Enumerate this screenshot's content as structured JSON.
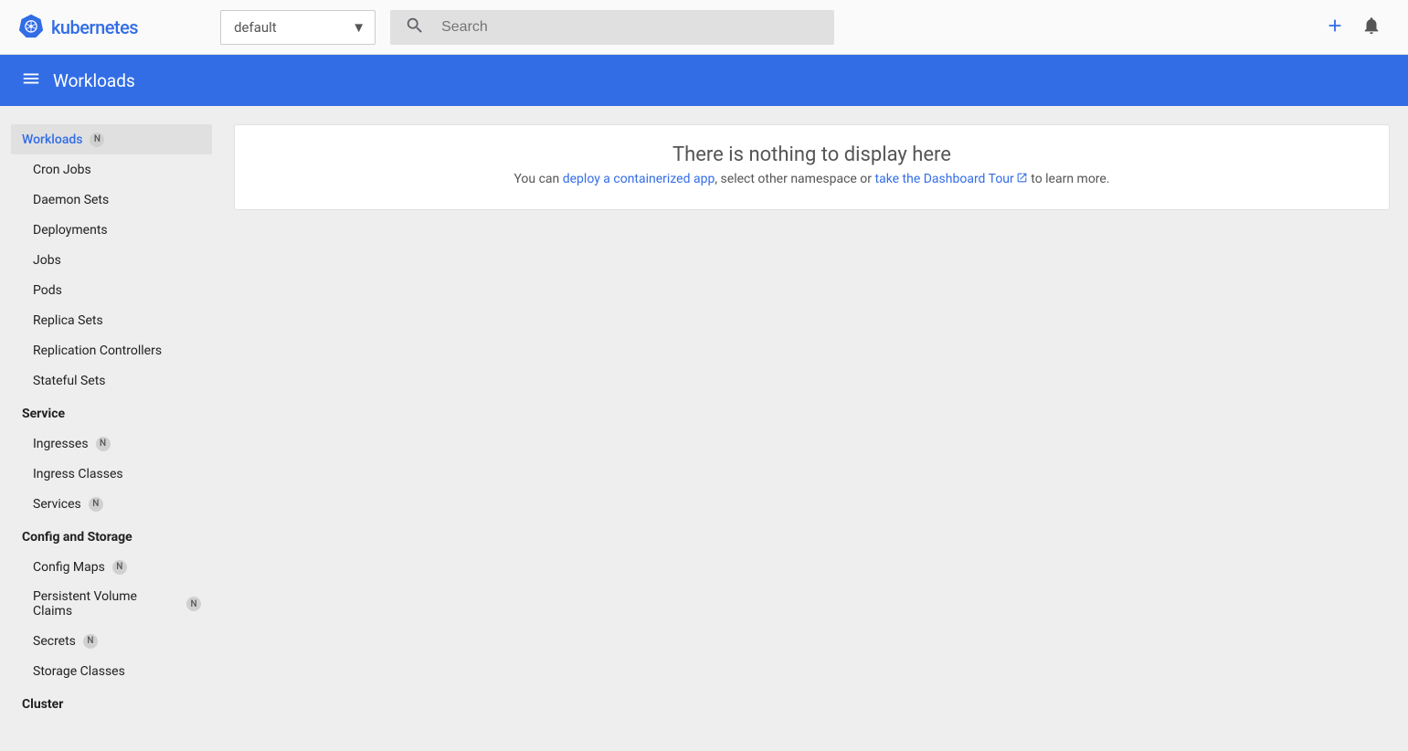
{
  "brand": "kubernetes",
  "namespaceSelector": {
    "value": "default"
  },
  "search": {
    "placeholder": "Search"
  },
  "breadcrumb": "Workloads",
  "sidebar": {
    "workloads": {
      "label": "Workloads",
      "badge": "N",
      "items": [
        "Cron Jobs",
        "Daemon Sets",
        "Deployments",
        "Jobs",
        "Pods",
        "Replica Sets",
        "Replication Controllers",
        "Stateful Sets"
      ]
    },
    "service": {
      "header": "Service",
      "items": [
        {
          "label": "Ingresses",
          "badge": "N"
        },
        {
          "label": "Ingress Classes"
        },
        {
          "label": "Services",
          "badge": "N"
        }
      ]
    },
    "config": {
      "header": "Config and Storage",
      "items": [
        {
          "label": "Config Maps",
          "badge": "N"
        },
        {
          "label": "Persistent Volume Claims",
          "badge": "N"
        },
        {
          "label": "Secrets",
          "badge": "N"
        },
        {
          "label": "Storage Classes"
        }
      ]
    },
    "cluster": {
      "header": "Cluster"
    }
  },
  "empty": {
    "title": "There is nothing to display here",
    "prefix": "You can ",
    "link1": "deploy a containerized app",
    "mid": ", select other namespace or ",
    "link2": "take the Dashboard Tour",
    "suffix": " to learn more."
  }
}
